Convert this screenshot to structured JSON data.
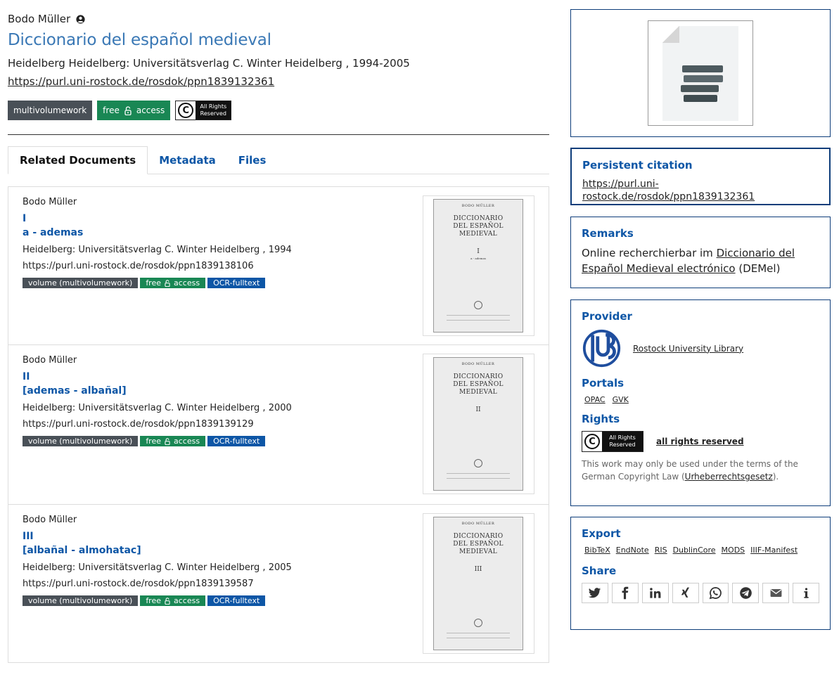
{
  "header": {
    "author": "Bodo Müller",
    "title": "Diccionario del español medieval",
    "publication": "Heidelberg Heidelberg: Universitätsverlag C. Winter Heidelberg , 1994-2005",
    "purl": "https://purl.uni-rostock.de/rosdok/ppn1839132361",
    "badge_type": "multivolumework",
    "badge_access_a": "free",
    "badge_access_b": "access",
    "cc_line1": "All Rights",
    "cc_line2": "Reserved"
  },
  "tabs": [
    "Related Documents",
    "Metadata",
    "Files"
  ],
  "documents": [
    {
      "author": "Bodo Müller",
      "number": "I",
      "range": "a - ademas",
      "publication": "Heidelberg: Universitätsverlag C. Winter Heidelberg , 1994",
      "url": "https://purl.uni-rostock.de/rosdok/ppn1839138106",
      "badge_type": "volume (multivolumework)",
      "badge_free": "free",
      "badge_access": "access",
      "badge_ocr": "OCR-fulltext",
      "cover_author": "BODO MÜLLER",
      "cover_title1": "DICCIONARIO",
      "cover_title2": "DEL ESPAÑOL MEDIEVAL",
      "cover_number": "I",
      "cover_sub": "a - ademas"
    },
    {
      "author": "Bodo Müller",
      "number": "II",
      "range": "[ademas - albañal]",
      "publication": "Heidelberg: Universitätsverlag C. Winter Heidelberg , 2000",
      "url": "https://purl.uni-rostock.de/rosdok/ppn1839139129",
      "badge_type": "volume (multivolumework)",
      "badge_free": "free",
      "badge_access": "access",
      "badge_ocr": "OCR-fulltext",
      "cover_author": "BODO MÜLLER",
      "cover_title1": "DICCIONARIO",
      "cover_title2": "DEL ESPAÑOL MEDIEVAL",
      "cover_number": "II",
      "cover_sub": ""
    },
    {
      "author": "Bodo Müller",
      "number": "III",
      "range": "[albañal - almohatac]",
      "publication": "Heidelberg: Universitätsverlag C. Winter Heidelberg , 2005",
      "url": "https://purl.uni-rostock.de/rosdok/ppn1839139587",
      "badge_type": "volume (multivolumework)",
      "badge_free": "free",
      "badge_access": "access",
      "badge_ocr": "OCR-fulltext",
      "cover_author": "BODO MÜLLER",
      "cover_title1": "DICCIONARIO",
      "cover_title2": "DEL ESPAÑOL MEDIEVAL",
      "cover_number": "III",
      "cover_sub": ""
    }
  ],
  "sidebar": {
    "citation_heading": "Persistent citation",
    "citation_url": "https://purl.uni-rostock.de/rosdok/ppn1839132361",
    "remarks_heading": "Remarks",
    "remarks_prefix": "Online recherchierbar im ",
    "remarks_link": "Diccionario del Español Medieval electrónico",
    "remarks_suffix": " (DEMel)",
    "provider_heading": "Provider",
    "provider_name": "Rostock University Library",
    "portals_heading": "Portals",
    "portals": [
      "OPAC",
      "GVK"
    ],
    "rights_heading": "Rights",
    "rights_link": "all rights reserved",
    "rights_text_prefix": "This work may only be used under the terms of the German Copyright Law (",
    "rights_text_link": "Urheberrechtsgesetz",
    "rights_text_suffix": ").",
    "export_heading": "Export",
    "export_links": [
      "BibTeX",
      "EndNote",
      "RIS",
      "DublinCore",
      "MODS",
      "IIIF-Manifest"
    ],
    "share_heading": "Share",
    "share_icons": [
      "twitter-icon",
      "facebook-icon",
      "linkedin-icon",
      "xing-icon",
      "whatsapp-icon",
      "telegram-icon",
      "mail-icon",
      "info-icon"
    ]
  },
  "colors": {
    "link_blue": "#0d56a6",
    "title_blue": "#3a78b5",
    "badge_dark": "#495057",
    "badge_green": "#198754",
    "badge_blue": "#0d56a6"
  }
}
